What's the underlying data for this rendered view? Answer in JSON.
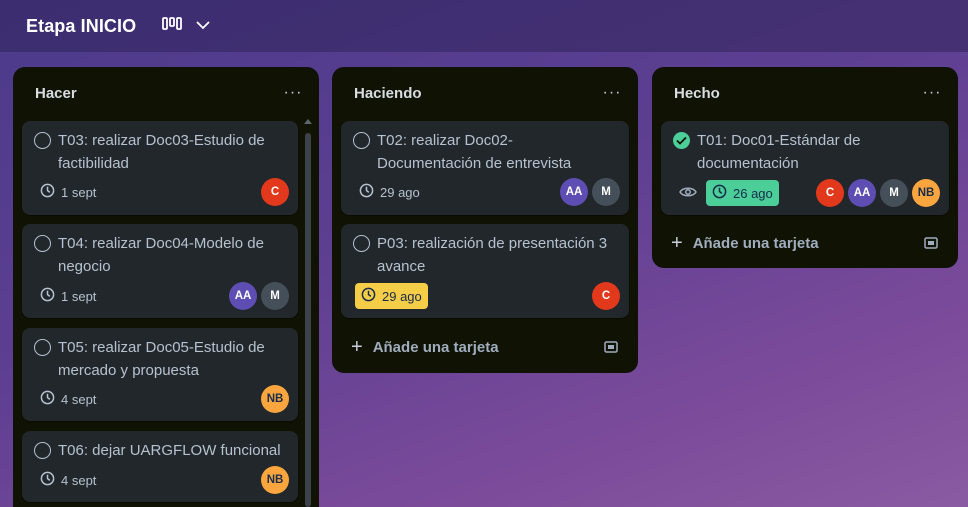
{
  "board": {
    "title": "Etapa INICIO",
    "view_icon": "board-view-icon",
    "chevron_icon": "chevron-down-icon"
  },
  "colors": {
    "list_bg": "#101204",
    "card_bg": "#22272b",
    "due_soon": "#f5cd47",
    "done": "#4bce97",
    "avatar_c": "#e2381b",
    "avatar_aa": "#5e4db2",
    "avatar_m": "#454f59",
    "avatar_nb": "#faa53d"
  },
  "lists": [
    {
      "title": "Hacer",
      "cards": [
        {
          "title": "T03: realizar Doc03-Estudio de factibilidad",
          "due": "1 sept",
          "members": [
            "C"
          ]
        },
        {
          "title": "T04: realizar Doc04-Modelo de negocio",
          "due": "1 sept",
          "members": [
            "AA",
            "M"
          ]
        },
        {
          "title": "T05: realizar Doc05-Estudio de mercado y propuesta",
          "due": "4 sept",
          "members": [
            "NB"
          ]
        },
        {
          "title": "T06: dejar UARGFLOW funcional",
          "due": "4 sept",
          "members": [
            "NB"
          ]
        }
      ]
    },
    {
      "title": "Haciendo",
      "cards": [
        {
          "title": "T02: realizar Doc02-Documentación de entrevista",
          "due": "29 ago",
          "members": [
            "AA",
            "M"
          ]
        },
        {
          "title": "P03: realización de presentación 3 avance",
          "due": "29 ago",
          "due_status": "soon",
          "members": [
            "C"
          ]
        }
      ],
      "add_label": "Añade una tarjeta"
    },
    {
      "title": "Hecho",
      "cards": [
        {
          "title": "T01: Doc01-Estándar de documentación",
          "due": "26 ago",
          "due_status": "complete",
          "completed": true,
          "watching": true,
          "members": [
            "C",
            "AA",
            "M",
            "NB"
          ]
        }
      ],
      "add_label": "Añade una tarjeta"
    }
  ],
  "list_menu_label": "···"
}
